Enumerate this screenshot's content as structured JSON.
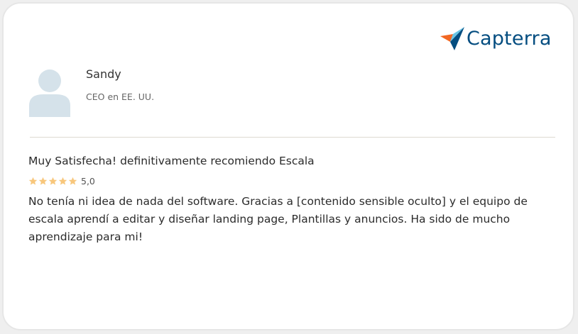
{
  "brand": {
    "name": "Capterra",
    "color": "#044d80",
    "accent_colors": [
      "#f26722",
      "#68c5e6",
      "#044d80"
    ]
  },
  "reviewer": {
    "name": "Sandy",
    "role": "CEO en EE. UU."
  },
  "review": {
    "title": "Muy Satisfecha! definitivamente recomiendo Escala",
    "rating": 5,
    "rating_label": "5,0",
    "star_color": "#f8c77c",
    "body": "No tenía ni idea de nada del software. Gracias a [contenido sensible oculto] y el equipo de escala aprendí a editar y diseñar landing page, Plantillas y anuncios. Ha sido de mucho aprendizaje para mi!"
  }
}
